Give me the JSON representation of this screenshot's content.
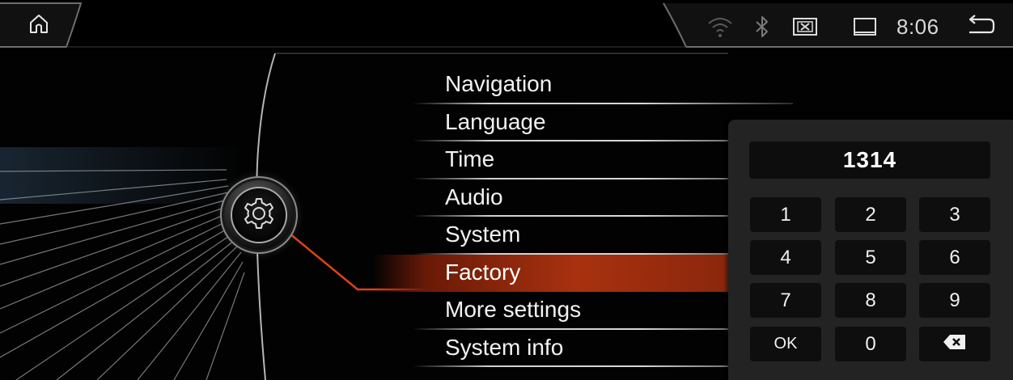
{
  "status_bar": {
    "clock": "8:06",
    "icons": [
      "home-icon",
      "wifi-icon",
      "bluetooth-icon",
      "close-box-icon",
      "window-icon",
      "back-icon"
    ]
  },
  "menu": {
    "items": [
      {
        "label": "Navigation",
        "selected": false
      },
      {
        "label": "Language",
        "selected": false
      },
      {
        "label": "Time",
        "selected": false
      },
      {
        "label": "Audio",
        "selected": false
      },
      {
        "label": "System",
        "selected": false
      },
      {
        "label": "Factory",
        "selected": true
      },
      {
        "label": "More settings",
        "selected": false
      },
      {
        "label": "System info",
        "selected": false
      }
    ]
  },
  "keypad": {
    "display_value": "1314",
    "keys": [
      "1",
      "2",
      "3",
      "4",
      "5",
      "6",
      "7",
      "8",
      "9",
      "OK",
      "0",
      "backspace"
    ]
  },
  "colors": {
    "accent": "#e0401a",
    "selected_row": "#a8310f",
    "keypad_bg": "#232323",
    "key_bg": "#0e0e0e"
  }
}
